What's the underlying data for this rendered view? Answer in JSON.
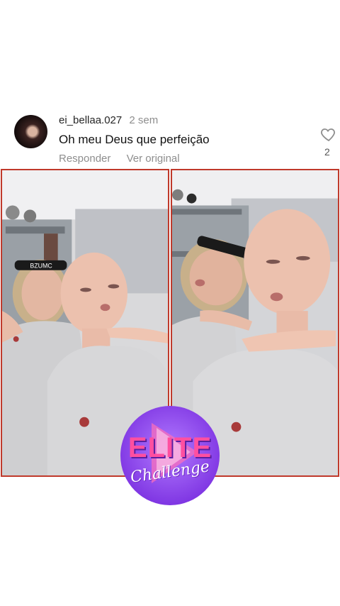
{
  "comment": {
    "username": "ei_bellaa.027",
    "time": "2 sem",
    "text": "Oh meu Deus que perfeição",
    "reply_label": "Responder",
    "translate_label": "Ver original",
    "like_count": "2"
  },
  "headband_text": "BZUMC",
  "badge": {
    "line1": "ELITE",
    "line2": "Challenge"
  },
  "colors": {
    "frame_border": "#c0392b",
    "badge_purple": "#8e44f0",
    "badge_pink": "#ff4fa0"
  }
}
